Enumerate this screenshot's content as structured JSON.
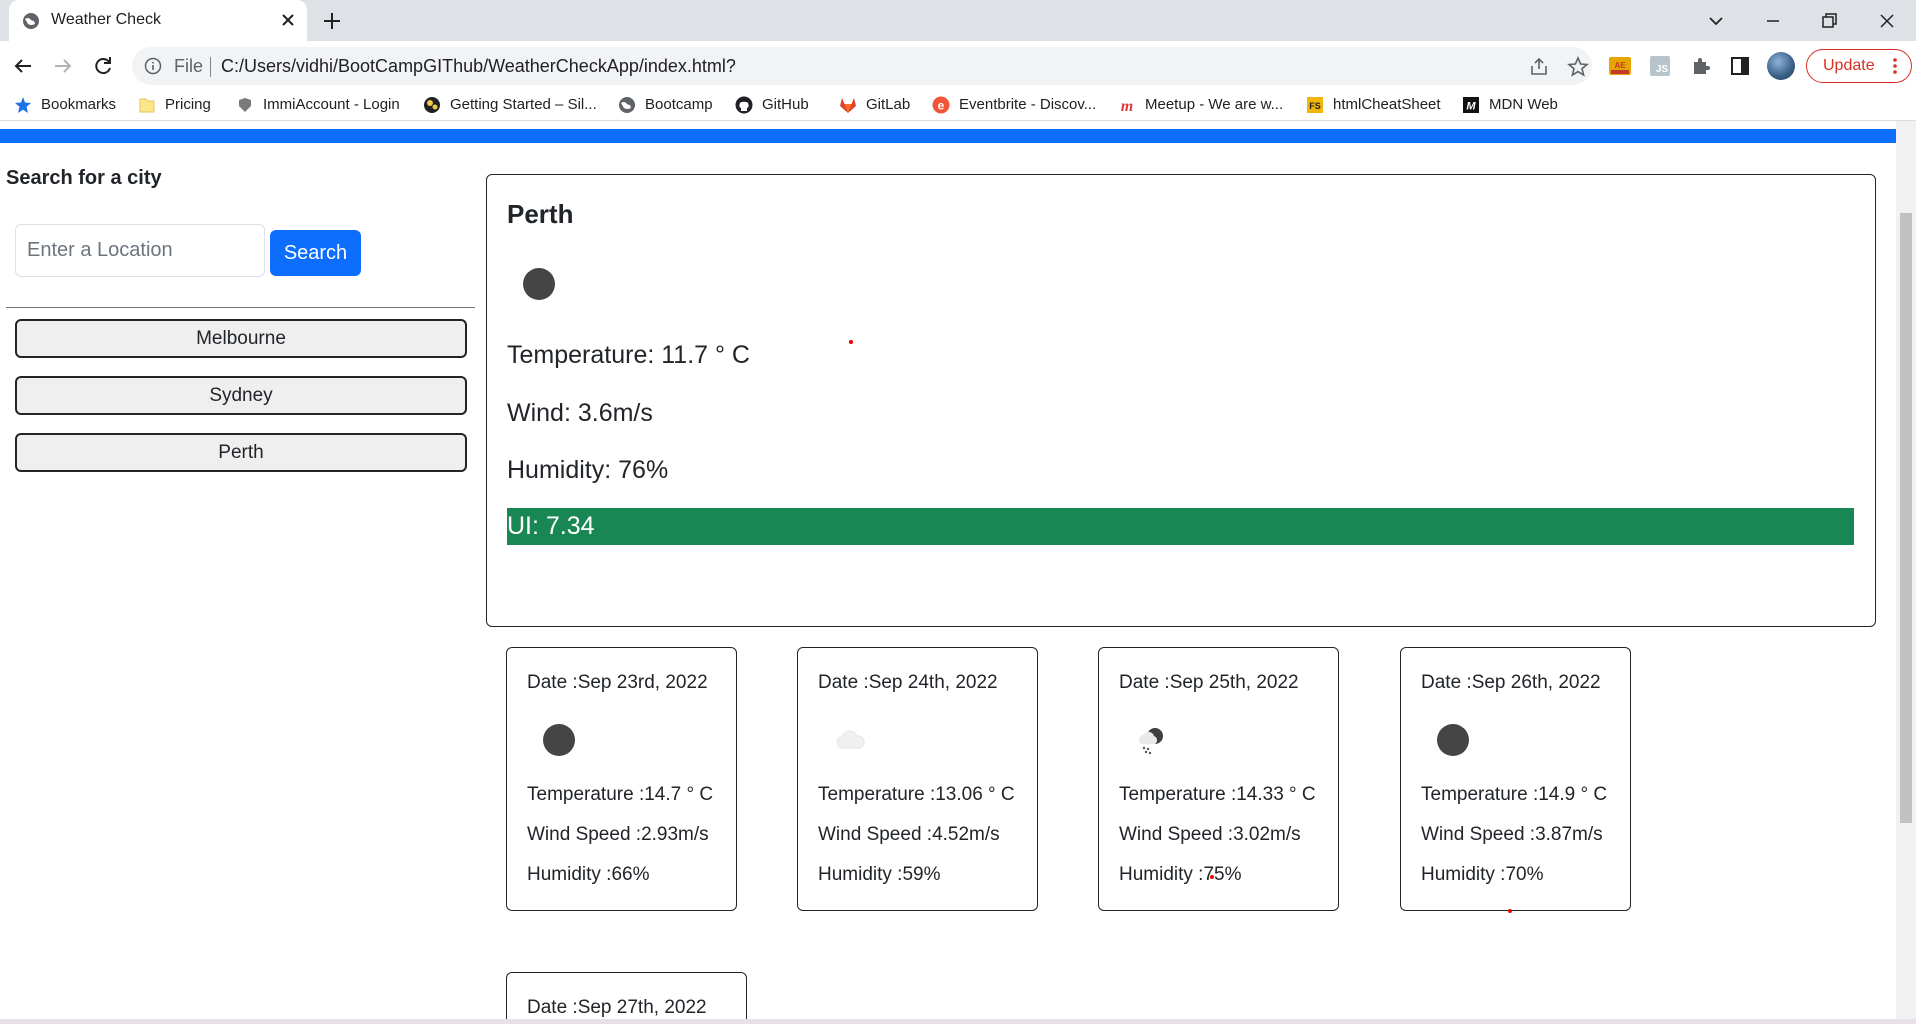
{
  "browser": {
    "tab_title": "Weather Check",
    "address_scheme": "File",
    "url": "C:/Users/vidhi/BootCampGIThub/WeatherCheckApp/index.html?",
    "update_label": "Update",
    "bookmarks": [
      {
        "label": "Bookmarks",
        "icon": "star-icon"
      },
      {
        "label": "Pricing",
        "icon": "folder-icon"
      },
      {
        "label": "ImmiAccount - Login",
        "icon": "crest-icon"
      },
      {
        "label": "Getting Started – Sil...",
        "icon": "gears-icon"
      },
      {
        "label": "Bootcamp",
        "icon": "globe-icon"
      },
      {
        "label": "GitHub",
        "icon": "github-icon"
      },
      {
        "label": "GitLab",
        "icon": "gitlab-icon"
      },
      {
        "label": "Eventbrite - Discov...",
        "icon": "eventbrite-icon"
      },
      {
        "label": "Meetup - We are w...",
        "icon": "meetup-icon"
      },
      {
        "label": "htmlCheatSheet",
        "icon": "fs-icon"
      },
      {
        "label": "MDN Web",
        "icon": "mdn-icon"
      }
    ]
  },
  "sidebar": {
    "title": "Search for a city",
    "search_placeholder": "Enter a Location",
    "search_button": "Search",
    "cities": [
      "Melbourne",
      "Sydney",
      "Perth"
    ]
  },
  "current": {
    "city": "Perth",
    "icon": "dark-circle-icon",
    "temperature": "Temperature: 11.7 ° C",
    "wind": "Wind: 3.6m/s",
    "humidity": "Humidity: 76%",
    "uv": "UI: 7.34",
    "uv_color": "#198754"
  },
  "forecast": [
    {
      "date": "Date :Sep 23rd, 2022",
      "icon": "dark-circle-icon",
      "temp": "Temperature :14.7 ° C",
      "wind": "Wind Speed :2.93m/s",
      "humidity": "Humidity :66%"
    },
    {
      "date": "Date :Sep 24th, 2022",
      "icon": "cloud-icon",
      "temp": "Temperature :13.06 ° C",
      "wind": "Wind Speed :4.52m/s",
      "humidity": "Humidity :59%"
    },
    {
      "date": "Date :Sep 25th, 2022",
      "icon": "cloud-rain-icon",
      "temp": "Temperature :14.33 ° C",
      "wind": "Wind Speed :3.02m/s",
      "humidity": "Humidity :75%"
    },
    {
      "date": "Date :Sep 26th, 2022",
      "icon": "dark-circle-icon",
      "temp": "Temperature :14.9 ° C",
      "wind": "Wind Speed :3.87m/s",
      "humidity": "Humidity :70%"
    },
    {
      "date": "Date :Sep 27th, 2022"
    }
  ],
  "colors": {
    "accent": "#0d6efd",
    "uv_bar": "#198754",
    "update": "#d93025"
  }
}
